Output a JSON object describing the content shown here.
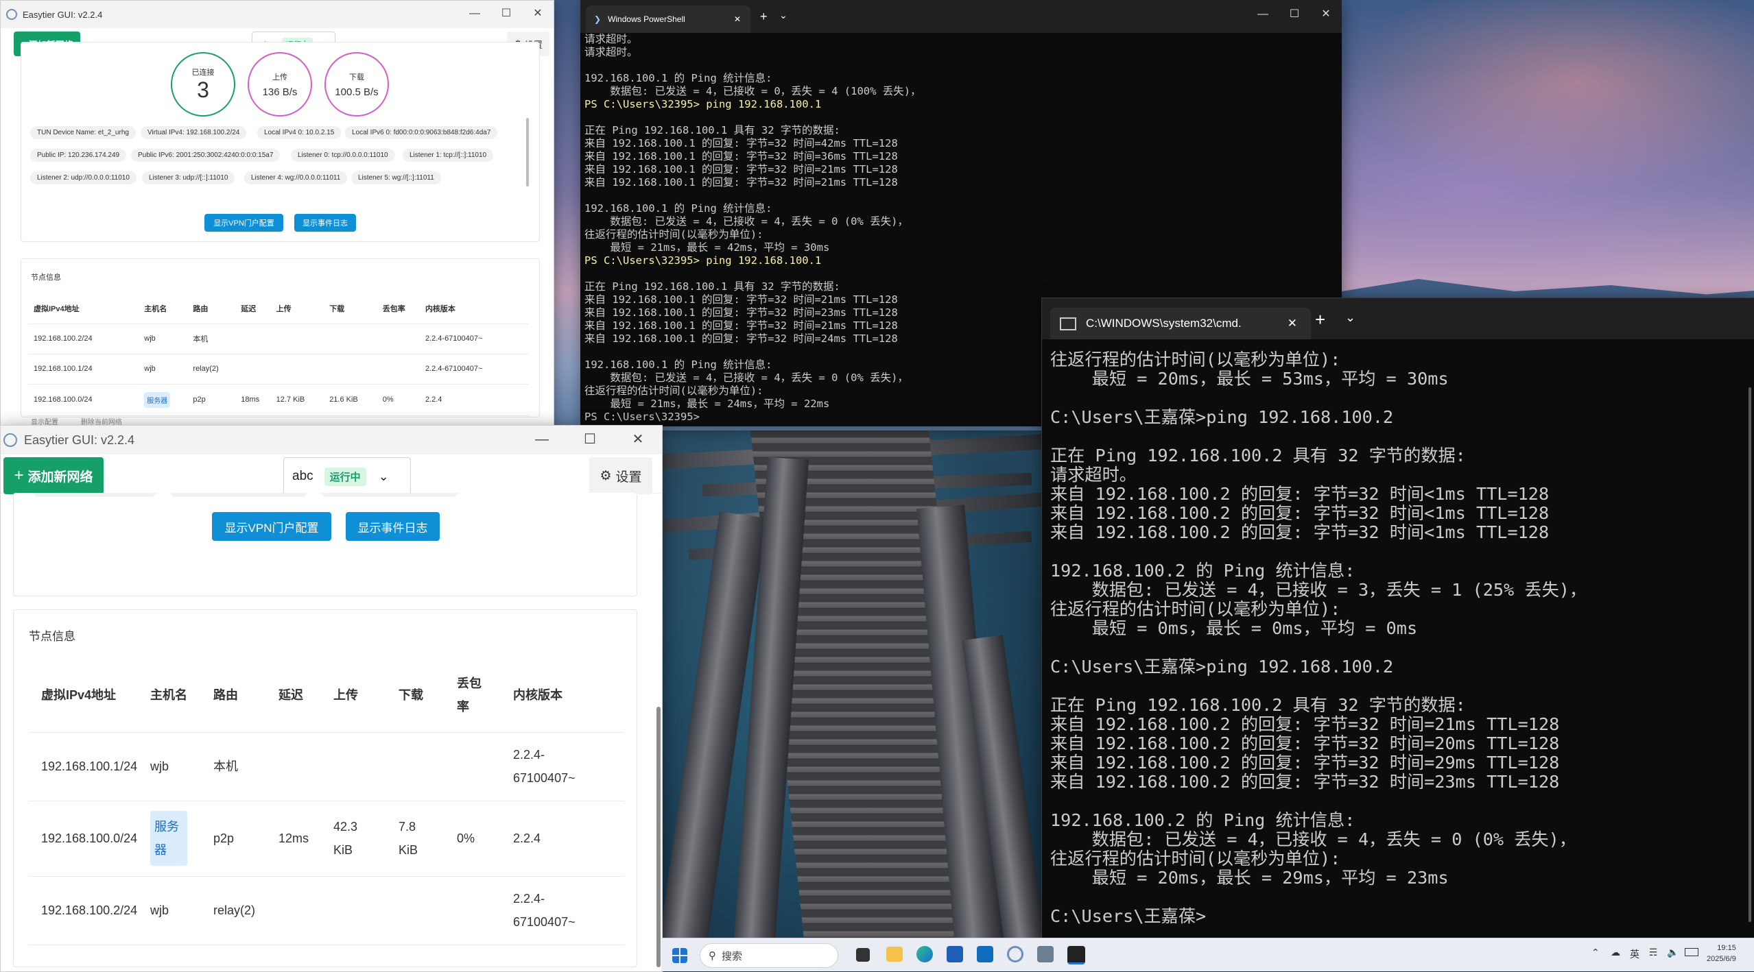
{
  "easytier_back": {
    "title": "Easytier GUI: v2.2.4",
    "add_network": "添加新网络",
    "network_name": "abc",
    "status": "运行中",
    "settings": "设置",
    "stats": [
      {
        "label": "已连接",
        "value": "3"
      },
      {
        "label": "上传",
        "value": "136 B/s"
      },
      {
        "label": "下载",
        "value": "100.5 B/s"
      }
    ],
    "chips_row1": [
      "TUN Device Name: et_2_urhg",
      "Virtual IPv4: 192.168.100.2/24",
      "Local IPv4 0: 10.0.2.15",
      "Local IPv6 0: fd00:0:0:0:9063:b848:f2d6:4da7"
    ],
    "chips_row2": [
      "Public IP: 120.236.174.249",
      "Public IPv6: 2001:250:3002:4240:0:0:0:15a7",
      "Listener 0: tcp://0.0.0.0:11010",
      "Listener 1: tcp://[::]:11010"
    ],
    "chips_row3": [
      "Listener 2: udp://0.0.0.0:11010",
      "Listener 3: udp://[::]:11010",
      "Listener 4: wg://0.0.0.0:11011",
      "Listener 5: wg://[::]:11011"
    ],
    "vpn_portal_btn": "显示VPN门户配置",
    "event_log_btn": "显示事件日志",
    "peer_section_title": "节点信息",
    "table_headers": [
      "虚拟IPv4地址",
      "主机名",
      "路由",
      "延迟",
      "上传",
      "下载",
      "丢包率",
      "内核版本"
    ],
    "rows": [
      {
        "ip": "192.168.100.2/24",
        "host": "wjb",
        "route": "本机",
        "latency": "",
        "up": "",
        "down": "",
        "loss": "",
        "version": "2.2.4-67100407~"
      },
      {
        "ip": "192.168.100.1/24",
        "host": "wjb",
        "route": "relay(2)",
        "latency": "",
        "up": "",
        "down": "",
        "loss": "",
        "version": "2.2.4-67100407~"
      },
      {
        "ip": "192.168.100.0/24",
        "host": "服务器",
        "route": "p2p",
        "latency": "18ms",
        "up": "12.7 KiB",
        "down": "21.6 KiB",
        "loss": "0%",
        "version": "2.2.4"
      }
    ],
    "footer_show_config": "显示配置",
    "footer_delete_network": "删除当前网络"
  },
  "easytier_front": {
    "title": "Easytier GUI: v2.2.4",
    "add_network": "添加新网络",
    "network_name": "abc",
    "status": "运行中",
    "settings": "设置",
    "vpn_portal_btn": "显示VPN门户配置",
    "event_log_btn": "显示事件日志",
    "peer_section_title": "节点信息",
    "table_headers": [
      "虚拟IPv4地址",
      "主机名",
      "路由",
      "延迟",
      "上传",
      "下载",
      "丢包率",
      "内核版本"
    ],
    "rows": [
      {
        "ip": "192.168.100.1/24",
        "host": "wjb",
        "route": "本机",
        "latency": "",
        "up": "",
        "down": "",
        "loss": "",
        "version": "2.2.4-67100407~"
      },
      {
        "ip": "192.168.100.0/24",
        "host": "服务器",
        "route": "p2p",
        "latency": "12ms",
        "up": "42.3 KiB",
        "down": "7.8 KiB",
        "loss": "0%",
        "version": "2.2.4"
      },
      {
        "ip": "192.168.100.2/24",
        "host": "wjb",
        "route": "relay(2)",
        "latency": "",
        "up": "",
        "down": "",
        "loss": "",
        "version": "2.2.4-67100407~"
      }
    ]
  },
  "powershell": {
    "tab_title": "Windows PowerShell",
    "lines": [
      {
        "t": "请求超时。",
        "c": "n"
      },
      {
        "t": "请求超时。",
        "c": "n"
      },
      {
        "t": "",
        "c": "n"
      },
      {
        "t": "192.168.100.1 的 Ping 统计信息:",
        "c": "n"
      },
      {
        "t": "    数据包: 已发送 = 4，已接收 = 0，丢失 = 4 (100% 丢失)，",
        "c": "n"
      },
      {
        "t": "PS C:\\Users\\32395> ping 192.168.100.1",
        "c": "p"
      },
      {
        "t": "",
        "c": "n"
      },
      {
        "t": "正在 Ping 192.168.100.1 具有 32 字节的数据:",
        "c": "n"
      },
      {
        "t": "来自 192.168.100.1 的回复: 字节=32 时间=42ms TTL=128",
        "c": "n"
      },
      {
        "t": "来自 192.168.100.1 的回复: 字节=32 时间=36ms TTL=128",
        "c": "n"
      },
      {
        "t": "来自 192.168.100.1 的回复: 字节=32 时间=21ms TTL=128",
        "c": "n"
      },
      {
        "t": "来自 192.168.100.1 的回复: 字节=32 时间=21ms TTL=128",
        "c": "n"
      },
      {
        "t": "",
        "c": "n"
      },
      {
        "t": "192.168.100.1 的 Ping 统计信息:",
        "c": "n"
      },
      {
        "t": "    数据包: 已发送 = 4，已接收 = 4，丢失 = 0 (0% 丢失)，",
        "c": "n"
      },
      {
        "t": "往返行程的估计时间(以毫秒为单位):",
        "c": "n"
      },
      {
        "t": "    最短 = 21ms，最长 = 42ms，平均 = 30ms",
        "c": "n"
      },
      {
        "t": "PS C:\\Users\\32395> ping 192.168.100.1",
        "c": "p"
      },
      {
        "t": "",
        "c": "n"
      },
      {
        "t": "正在 Ping 192.168.100.1 具有 32 字节的数据:",
        "c": "n"
      },
      {
        "t": "来自 192.168.100.1 的回复: 字节=32 时间=21ms TTL=128",
        "c": "n"
      },
      {
        "t": "来自 192.168.100.1 的回复: 字节=32 时间=23ms TTL=128",
        "c": "n"
      },
      {
        "t": "来自 192.168.100.1 的回复: 字节=32 时间=21ms TTL=128",
        "c": "n"
      },
      {
        "t": "来自 192.168.100.1 的回复: 字节=32 时间=24ms TTL=128",
        "c": "n"
      },
      {
        "t": "",
        "c": "n"
      },
      {
        "t": "192.168.100.1 的 Ping 统计信息:",
        "c": "n"
      },
      {
        "t": "    数据包: 已发送 = 4，已接收 = 4，丢失 = 0 (0% 丢失)，",
        "c": "n"
      },
      {
        "t": "往返行程的估计时间(以毫秒为单位):",
        "c": "n"
      },
      {
        "t": "    最短 = 21ms，最长 = 24ms，平均 = 22ms",
        "c": "n"
      },
      {
        "t": "PS C:\\Users\\32395>",
        "c": "n"
      }
    ]
  },
  "cmd": {
    "tab_title": "C:\\WINDOWS\\system32\\cmd.",
    "lines": [
      "往返行程的估计时间(以毫秒为单位):",
      "    最短 = 20ms，最长 = 53ms，平均 = 30ms",
      "",
      "C:\\Users\\王嘉葆>ping 192.168.100.2",
      "",
      "正在 Ping 192.168.100.2 具有 32 字节的数据:",
      "请求超时。",
      "来自 192.168.100.2 的回复: 字节=32 时间<1ms TTL=128",
      "来自 192.168.100.2 的回复: 字节=32 时间<1ms TTL=128",
      "来自 192.168.100.2 的回复: 字节=32 时间<1ms TTL=128",
      "",
      "192.168.100.2 的 Ping 统计信息:",
      "    数据包: 已发送 = 4，已接收 = 3，丢失 = 1 (25% 丢失)，",
      "往返行程的估计时间(以毫秒为单位):",
      "    最短 = 0ms，最长 = 0ms，平均 = 0ms",
      "",
      "C:\\Users\\王嘉葆>ping 192.168.100.2",
      "",
      "正在 Ping 192.168.100.2 具有 32 字节的数据:",
      "来自 192.168.100.2 的回复: 字节=32 时间=21ms TTL=128",
      "来自 192.168.100.2 的回复: 字节=32 时间=20ms TTL=128",
      "来自 192.168.100.2 的回复: 字节=32 时间=29ms TTL=128",
      "来自 192.168.100.2 的回复: 字节=32 时间=23ms TTL=128",
      "",
      "192.168.100.2 的 Ping 统计信息:",
      "    数据包: 已发送 = 4，已接收 = 4，丢失 = 0 (0% 丢失)，",
      "往返行程的估计时间(以毫秒为单位):",
      "    最短 = 20ms，最长 = 29ms，平均 = 23ms",
      "",
      "C:\\Users\\王嘉葆>"
    ]
  },
  "taskbar": {
    "search_placeholder": "搜索",
    "ime": "英",
    "time": "19:15",
    "date": "2025/6/9"
  },
  "colors": {
    "brand_green": "#15a06a",
    "portal_blue": "#0f8fd6",
    "terminal_bg": "#0c0c0c",
    "ps_prompt_yellow": "#f9f1a5"
  }
}
